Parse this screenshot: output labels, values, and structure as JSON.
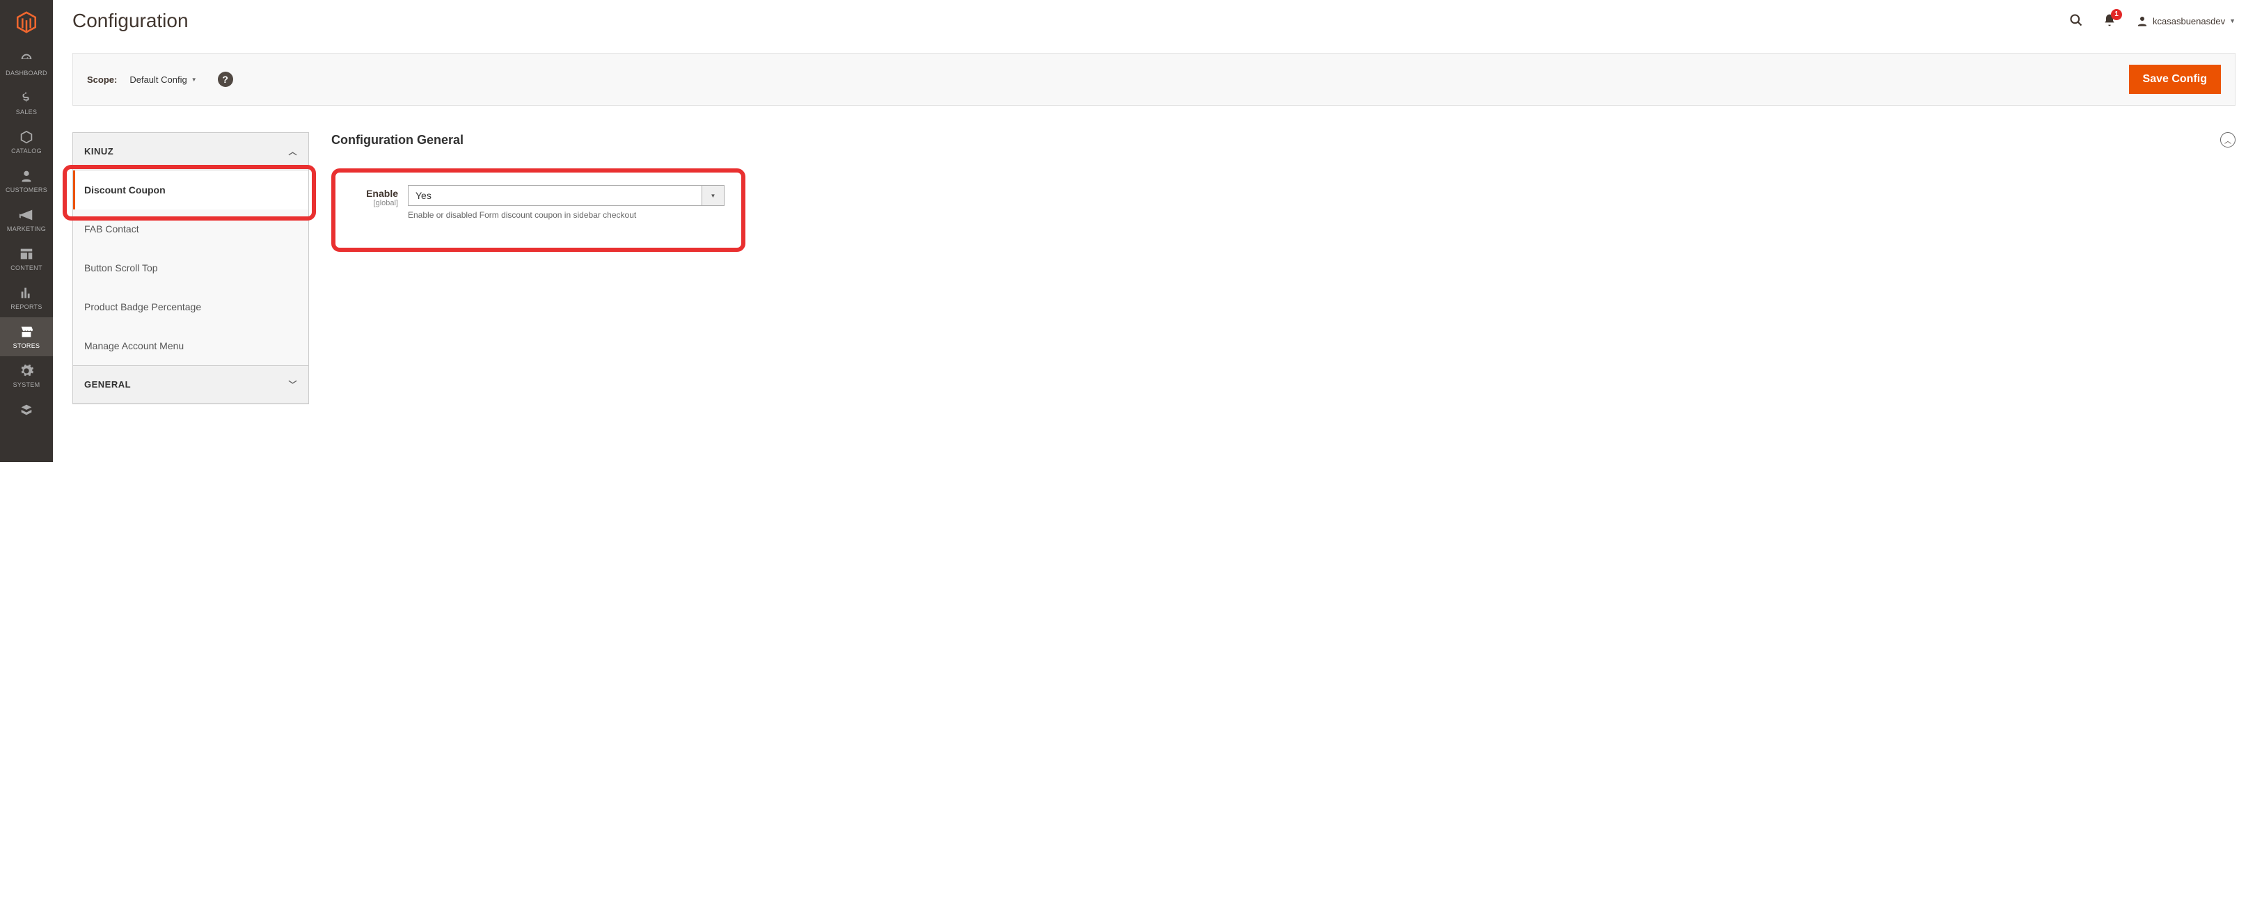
{
  "page": {
    "title": "Configuration"
  },
  "user": {
    "name": "kcasasbuenasdev",
    "notification_count": "1"
  },
  "scope": {
    "label": "Scope:",
    "value": "Default Config"
  },
  "buttons": {
    "save": "Save Config"
  },
  "sidebar": {
    "items": [
      {
        "label": "DASHBOARD"
      },
      {
        "label": "SALES"
      },
      {
        "label": "CATALOG"
      },
      {
        "label": "CUSTOMERS"
      },
      {
        "label": "MARKETING"
      },
      {
        "label": "CONTENT"
      },
      {
        "label": "REPORTS"
      },
      {
        "label": "STORES"
      },
      {
        "label": "SYSTEM"
      }
    ]
  },
  "config_tabs": {
    "group1": {
      "title": "KINUZ",
      "expanded": true,
      "items": [
        {
          "label": "Discount Coupon",
          "active": true
        },
        {
          "label": "FAB Contact"
        },
        {
          "label": "Button Scroll Top"
        },
        {
          "label": "Product Badge Percentage"
        },
        {
          "label": "Manage Account Menu"
        }
      ]
    },
    "group2": {
      "title": "GENERAL",
      "expanded": false
    }
  },
  "panel": {
    "title": "Configuration General",
    "field": {
      "label": "Enable",
      "scope": "[global]",
      "value": "Yes",
      "note": "Enable or disabled Form discount coupon in sidebar checkout"
    }
  }
}
